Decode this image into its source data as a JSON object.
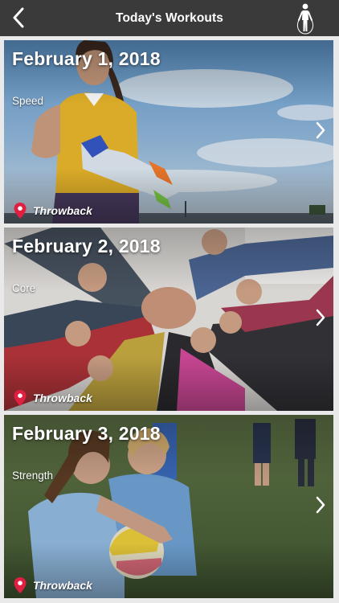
{
  "header": {
    "title": "Today's Workouts",
    "back_icon": "chevron-left-icon",
    "profile_icon": "jump-rope-figure-icon"
  },
  "workouts": [
    {
      "date": "February 1, 2018",
      "category": "Speed",
      "location": "Throwback"
    },
    {
      "date": "February 2, 2018",
      "category": "Core",
      "location": "Throwback"
    },
    {
      "date": "February 3, 2018",
      "category": "Strength",
      "location": "Throwback"
    }
  ],
  "colors": {
    "navbar": "#3a3a3a",
    "background": "#e9e9e9",
    "pin": "#e02040",
    "text": "#ffffff"
  }
}
